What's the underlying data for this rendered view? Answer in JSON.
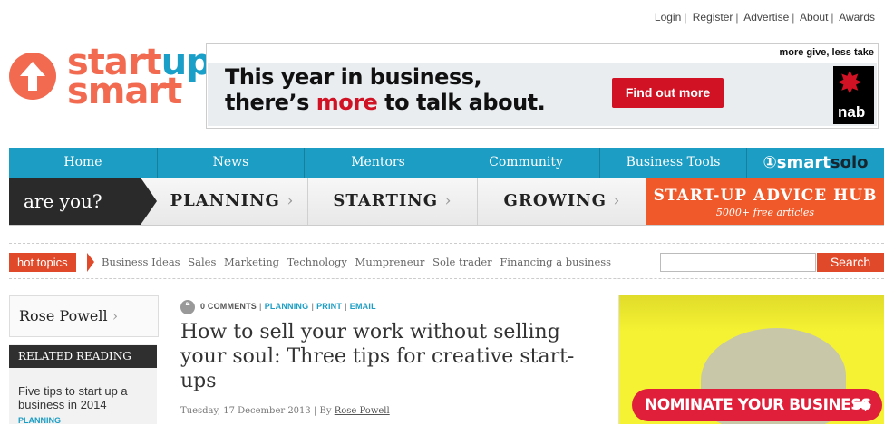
{
  "top_links": [
    "Login",
    "Register",
    "Advertise",
    "About",
    "Awards"
  ],
  "logo": {
    "word1_a": "start",
    "word1_b": "up",
    "word2": "smart"
  },
  "banner": {
    "line1": "This year in business,",
    "line2_a": "there’s ",
    "line2_more": "more",
    "line2_b": " to talk about.",
    "cta": "Find out more",
    "tagline": "more give, less take",
    "brand": "nab"
  },
  "main_nav": {
    "items": [
      "Home",
      "News",
      "Mentors",
      "Community",
      "Business Tools"
    ],
    "smartsolo_a": "smart",
    "smartsolo_b": "solo"
  },
  "stage_nav": {
    "prompt": "are you?",
    "stages": [
      "PLANNING",
      "STARTING",
      "GROWING"
    ],
    "hub_title": "START-UP ADVICE HUB",
    "hub_subtitle": "5000+ free articles"
  },
  "topics": {
    "label": "hot topics",
    "links": [
      "Business Ideas",
      "Sales",
      "Marketing",
      "Technology",
      "Mumpreneur",
      "Sole trader",
      "Financing a business"
    ],
    "search_button": "Search"
  },
  "sidebar": {
    "author": "Rose Powell",
    "related_header": "RELATED READING",
    "related_title": "Five tips to start up a business in 2014",
    "related_category": "PLANNING"
  },
  "article": {
    "comments": "0 COMMENTS",
    "category": "PLANNING",
    "print": "PRINT",
    "email": "EMAIL",
    "headline": "How to sell your work without selling your soul: Three tips for creative start-ups",
    "date": "Tuesday, 17 December 2013",
    "by": "By",
    "author": "Rose Powell"
  },
  "right_ad": {
    "cta": "NOMINATE YOUR BUSINESS"
  },
  "colors": {
    "brand_orange": "#f26a50",
    "nav_blue": "#1b9dc4",
    "hub_orange": "#f05a2a",
    "nab_red": "#d11224"
  }
}
